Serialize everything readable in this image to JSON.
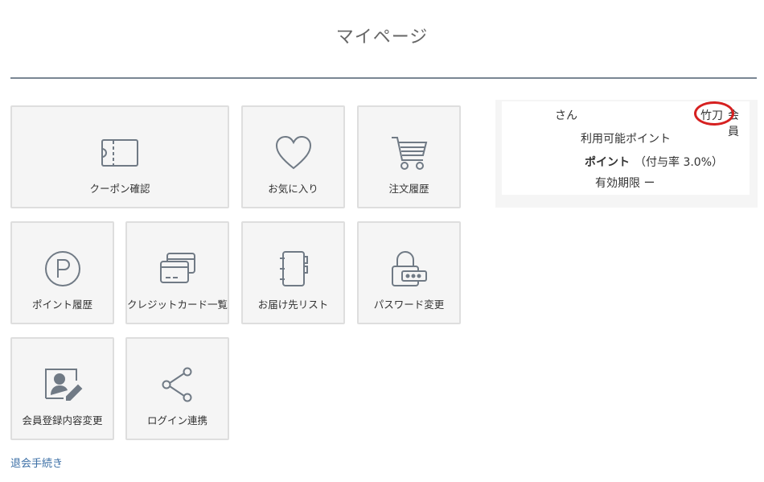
{
  "page": {
    "title": "マイページ"
  },
  "menu": [
    {
      "label": "クーポン確認",
      "icon": "coupon-ticket-icon"
    },
    {
      "label": "お気に入り",
      "icon": "heart-icon"
    },
    {
      "label": "注文履歴",
      "icon": "cart-icon"
    },
    {
      "label": "ポイント履歴",
      "icon": "point-p-icon"
    },
    {
      "label": "クレジットカード一覧",
      "icon": "credit-card-icon"
    },
    {
      "label": "お届け先リスト",
      "icon": "address-book-icon"
    },
    {
      "label": "パスワード変更",
      "icon": "lock-password-icon"
    },
    {
      "label": "会員登録内容変更",
      "icon": "profile-edit-icon"
    },
    {
      "label": "ログイン連携",
      "icon": "share-icon"
    }
  ],
  "member": {
    "name_suffix": "さん",
    "rank": "竹刀",
    "rank_suffix": "会員",
    "points_label": "利用可能ポイント",
    "points_unit": "ポイント",
    "points_rate": "（付与率 3.0%）",
    "expiry_label": "有効期限",
    "expiry_value": "ー"
  },
  "footer": {
    "withdraw_link": "退会手続き"
  },
  "colors": {
    "accent_link": "#3a6ea5",
    "highlight_circle": "#d62020",
    "icon_stroke": "#707a85"
  }
}
